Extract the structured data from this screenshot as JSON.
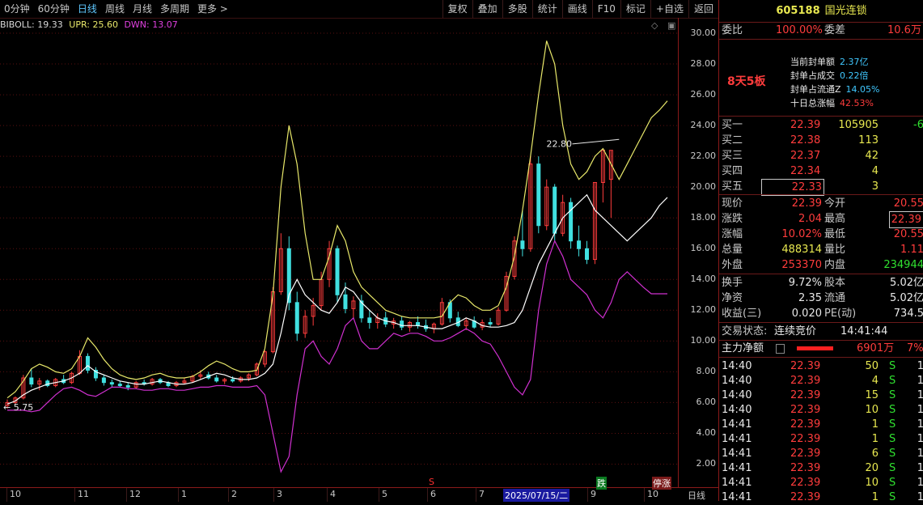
{
  "toolbar": {
    "periods": [
      "0分钟",
      "60分钟",
      "日线",
      "周线",
      "月线",
      "多周期",
      "更多 >"
    ],
    "active_period": "日线",
    "tools": [
      "复权",
      "叠加",
      "多股",
      "统计",
      "画线",
      "F10",
      "标记",
      "+自选",
      "返回"
    ]
  },
  "indicator": {
    "boll": "BIBOLL: 19.33",
    "upr": "UPR: 25.60",
    "dwn": "DWN: 13.07"
  },
  "y_axis_labels": [
    "30.00",
    "28.00",
    "26.00",
    "24.00",
    "22.00",
    "20.00",
    "18.00",
    "16.00",
    "14.00",
    "12.00",
    "10.00",
    "8.00",
    "6.00",
    "4.00",
    "2.00"
  ],
  "annotations": {
    "high_price": "22.80",
    "low_price": "5.75"
  },
  "x_axis": {
    "labels": [
      "10",
      "11",
      "12",
      "1",
      "2",
      "3",
      "4",
      "5",
      "6",
      "7",
      "9",
      "10"
    ],
    "cursor_date": "2025/07/15/二",
    "period": "日线",
    "mark_fall": "跌",
    "mark_halt": "停涨",
    "mark_s": "S"
  },
  "colors": {
    "up": "#ff3c3c",
    "down": "#40e0e0",
    "mid": "#ffffff",
    "upper": "#e8e86a",
    "lower": "#d030d0"
  },
  "chart_data": {
    "type": "line",
    "title": "",
    "ylim": [
      0.5,
      31
    ],
    "x": [
      0,
      1,
      2,
      3,
      4,
      5,
      6,
      7,
      8,
      9,
      10,
      11,
      12,
      13,
      14,
      15,
      16,
      17,
      18,
      19,
      20,
      21,
      22,
      23,
      24,
      25,
      26,
      27,
      28,
      29,
      30,
      31,
      32,
      33,
      34,
      35,
      36,
      37,
      38,
      39,
      40,
      41,
      42,
      43,
      44,
      45,
      46,
      47,
      48,
      49,
      50,
      51,
      52,
      53,
      54,
      55,
      56,
      57,
      58,
      59,
      60,
      61,
      62,
      63,
      64,
      65,
      66,
      67,
      68,
      69,
      70,
      71,
      72,
      73,
      74,
      75,
      76,
      77,
      78,
      79,
      80,
      81,
      82
    ],
    "series": [
      {
        "name": "BIBOLL",
        "values": [
          5.9,
          6.1,
          6.5,
          6.8,
          7.0,
          7.2,
          7.3,
          7.4,
          7.6,
          7.9,
          8.4,
          8.0,
          7.8,
          7.6,
          7.4,
          7.3,
          7.2,
          7.2,
          7.3,
          7.4,
          7.3,
          7.2,
          7.2,
          7.3,
          7.5,
          7.7,
          7.9,
          7.8,
          7.6,
          7.5,
          7.5,
          7.6,
          7.9,
          8.5,
          10.5,
          13.0,
          14.0,
          13.0,
          12.5,
          12.0,
          11.8,
          12.5,
          13.5,
          13.2,
          12.5,
          12.0,
          11.5,
          11.3,
          11.2,
          11.0,
          11.0,
          11.0,
          10.9,
          10.8,
          10.8,
          11.0,
          11.2,
          11.5,
          11.3,
          11.0,
          10.9,
          10.9,
          11.0,
          11.2,
          12.0,
          13.5,
          15.0,
          16.0,
          17.0,
          18.0,
          18.5,
          19.0,
          19.5,
          18.5,
          18.0,
          17.5,
          17.0,
          16.5,
          17.0,
          17.5,
          18.0,
          18.8,
          19.33
        ]
      },
      {
        "name": "UPR",
        "values": [
          6.3,
          6.7,
          7.4,
          8.2,
          8.5,
          8.3,
          8.0,
          7.9,
          8.2,
          9.0,
          10.2,
          9.6,
          8.8,
          8.2,
          7.8,
          7.6,
          7.5,
          7.6,
          7.8,
          7.9,
          7.7,
          7.6,
          7.6,
          7.7,
          8.0,
          8.4,
          8.7,
          8.5,
          8.2,
          8.0,
          8.0,
          8.1,
          9.5,
          13.0,
          20.0,
          24.0,
          21.5,
          17.0,
          14.0,
          14.0,
          15.5,
          17.5,
          16.5,
          14.5,
          13.5,
          13.0,
          12.5,
          12.0,
          11.8,
          11.6,
          11.5,
          11.5,
          11.5,
          11.5,
          11.6,
          12.5,
          13.0,
          12.8,
          12.3,
          12.0,
          12.0,
          12.3,
          13.5,
          15.5,
          18.5,
          22.0,
          26.0,
          29.5,
          28.0,
          24.0,
          21.5,
          20.5,
          21.0,
          22.0,
          22.5,
          21.5,
          20.5,
          21.5,
          22.5,
          23.5,
          24.5,
          25.0,
          25.6
        ]
      },
      {
        "name": "DWN",
        "values": [
          5.5,
          5.5,
          5.5,
          5.4,
          5.5,
          6.0,
          6.5,
          6.9,
          7.0,
          6.8,
          6.5,
          6.4,
          6.7,
          7.0,
          7.0,
          6.9,
          6.9,
          6.8,
          6.8,
          6.9,
          6.9,
          6.8,
          6.8,
          6.9,
          7.0,
          7.0,
          7.1,
          7.1,
          7.0,
          7.0,
          7.0,
          7.1,
          6.5,
          4.0,
          1.5,
          2.5,
          6.5,
          9.5,
          10.0,
          9.0,
          8.5,
          9.5,
          11.0,
          11.5,
          10.0,
          9.5,
          9.5,
          10.0,
          10.5,
          10.3,
          10.5,
          10.5,
          10.3,
          10.0,
          10.0,
          10.2,
          10.5,
          10.8,
          10.5,
          10.0,
          9.8,
          9.0,
          8.0,
          7.0,
          6.5,
          7.5,
          12.0,
          15.0,
          16.5,
          15.5,
          14.0,
          13.5,
          13.0,
          12.0,
          11.5,
          12.5,
          14.0,
          14.5,
          14.0,
          13.5,
          13.07,
          13.07,
          13.07
        ]
      }
    ],
    "candles": [
      [
        5.8,
        6.2,
        5.6,
        6.0
      ],
      [
        6.0,
        6.4,
        5.9,
        6.3
      ],
      [
        6.3,
        7.8,
        6.2,
        7.6
      ],
      [
        7.6,
        8.2,
        7.0,
        7.2
      ],
      [
        7.2,
        7.6,
        6.8,
        7.4
      ],
      [
        7.4,
        7.5,
        7.0,
        7.1
      ],
      [
        7.1,
        7.6,
        7.0,
        7.5
      ],
      [
        7.5,
        7.8,
        7.2,
        7.3
      ],
      [
        7.3,
        8.0,
        7.2,
        7.9
      ],
      [
        7.9,
        9.4,
        7.8,
        9.0
      ],
      [
        9.0,
        9.2,
        7.9,
        8.1
      ],
      [
        8.1,
        8.3,
        7.4,
        7.6
      ],
      [
        7.6,
        7.8,
        7.1,
        7.3
      ],
      [
        7.3,
        7.5,
        7.0,
        7.2
      ],
      [
        7.2,
        7.4,
        7.0,
        7.1
      ],
      [
        7.1,
        7.3,
        6.8,
        7.0
      ],
      [
        7.0,
        7.4,
        6.9,
        7.3
      ],
      [
        7.3,
        7.5,
        7.1,
        7.2
      ],
      [
        7.2,
        7.6,
        7.1,
        7.5
      ],
      [
        7.5,
        7.6,
        7.2,
        7.3
      ],
      [
        7.3,
        7.4,
        7.0,
        7.1
      ],
      [
        7.1,
        7.4,
        7.0,
        7.3
      ],
      [
        7.3,
        7.6,
        7.2,
        7.4
      ],
      [
        7.4,
        7.8,
        7.3,
        7.7
      ],
      [
        7.7,
        8.1,
        7.5,
        7.8
      ],
      [
        7.8,
        8.0,
        7.5,
        7.6
      ],
      [
        7.6,
        7.8,
        7.3,
        7.4
      ],
      [
        7.4,
        7.6,
        7.2,
        7.5
      ],
      [
        7.5,
        7.7,
        7.3,
        7.4
      ],
      [
        7.4,
        7.7,
        7.3,
        7.6
      ],
      [
        7.6,
        7.9,
        7.4,
        7.8
      ],
      [
        7.8,
        8.6,
        7.7,
        8.5
      ],
      [
        8.5,
        9.4,
        8.3,
        9.3
      ],
      [
        9.3,
        13.5,
        9.2,
        13.2
      ],
      [
        13.2,
        17.0,
        13.0,
        16.0
      ],
      [
        16.0,
        16.8,
        12.0,
        12.5
      ],
      [
        12.5,
        13.2,
        10.0,
        10.5
      ],
      [
        10.5,
        12.0,
        10.2,
        11.6
      ],
      [
        11.6,
        12.8,
        11.0,
        12.3
      ],
      [
        12.3,
        14.5,
        12.0,
        14.0
      ],
      [
        14.0,
        16.5,
        13.5,
        16.0
      ],
      [
        16.0,
        16.2,
        12.5,
        13.0
      ],
      [
        13.0,
        13.8,
        11.8,
        12.1
      ],
      [
        12.1,
        12.9,
        11.5,
        12.6
      ],
      [
        12.6,
        13.0,
        11.2,
        11.5
      ],
      [
        11.5,
        12.0,
        10.8,
        11.2
      ],
      [
        11.2,
        11.8,
        10.8,
        11.5
      ],
      [
        11.5,
        11.9,
        10.9,
        11.1
      ],
      [
        11.1,
        11.5,
        10.8,
        11.3
      ],
      [
        11.3,
        11.6,
        10.7,
        10.9
      ],
      [
        10.9,
        11.3,
        10.6,
        11.2
      ],
      [
        11.2,
        11.6,
        10.8,
        11.0
      ],
      [
        11.0,
        11.4,
        10.6,
        10.8
      ],
      [
        10.8,
        11.2,
        10.5,
        11.1
      ],
      [
        11.1,
        12.8,
        11.0,
        12.5
      ],
      [
        12.5,
        12.7,
        11.2,
        11.5
      ],
      [
        11.5,
        11.9,
        10.9,
        11.0
      ],
      [
        11.0,
        11.5,
        10.7,
        11.3
      ],
      [
        11.3,
        11.6,
        10.8,
        10.9
      ],
      [
        10.9,
        11.4,
        10.7,
        11.2
      ],
      [
        11.2,
        11.5,
        10.9,
        11.1
      ],
      [
        11.1,
        12.2,
        11.0,
        12.0
      ],
      [
        12.0,
        14.5,
        11.9,
        14.2
      ],
      [
        14.2,
        16.8,
        14.0,
        16.5
      ],
      [
        16.5,
        18.5,
        15.5,
        16.0
      ],
      [
        16.0,
        22.0,
        15.8,
        21.5
      ],
      [
        21.5,
        22.0,
        17.0,
        17.5
      ],
      [
        17.5,
        20.5,
        17.2,
        20.0
      ],
      [
        20.0,
        20.2,
        16.5,
        17.0
      ],
      [
        17.0,
        19.5,
        16.8,
        19.0
      ],
      [
        19.0,
        19.3,
        16.0,
        16.5
      ],
      [
        16.5,
        17.5,
        15.5,
        16.0
      ],
      [
        16.0,
        16.5,
        15.0,
        15.3
      ],
      [
        15.3,
        20.3,
        15.0,
        20.3
      ],
      [
        20.3,
        22.4,
        19.0,
        22.4
      ],
      [
        20.5,
        22.4,
        18.0,
        22.39
      ]
    ]
  },
  "panel": {
    "code": "605188",
    "name": "国光连锁",
    "weibi_label": "委比",
    "weibi_value": "100.00%",
    "weicha_label": "委差",
    "weicha_value": "10.6万",
    "seal_title": "8天5板",
    "seal_lines": [
      {
        "label": "当前封单额",
        "value": "2.37亿"
      },
      {
        "label": "封单占成交",
        "value": "0.22倍"
      },
      {
        "label": "封单占流通Z",
        "value": "14.05%"
      },
      {
        "label": "十日总涨幅",
        "value": "42.53%"
      }
    ],
    "bids": [
      {
        "label": "买一",
        "price": "22.39",
        "vol": "105905",
        "chg": "-6"
      },
      {
        "label": "买二",
        "price": "22.38",
        "vol": "113",
        "chg": ""
      },
      {
        "label": "买三",
        "price": "22.37",
        "vol": "42",
        "chg": ""
      },
      {
        "label": "买四",
        "price": "22.34",
        "vol": "4",
        "chg": ""
      },
      {
        "label": "买五",
        "price": "22.33",
        "vol": "3",
        "chg": ""
      }
    ],
    "quote": [
      {
        "l1": "现价",
        "v1": "22.39",
        "l2": "今开",
        "v2": "20.55"
      },
      {
        "l1": "涨跌",
        "v1": "2.04",
        "l2": "最高",
        "v2": "22.39"
      },
      {
        "l1": "涨幅",
        "v1": "10.02%",
        "l2": "最低",
        "v2": "20.55"
      },
      {
        "l1": "总量",
        "v1": "488314",
        "l2": "量比",
        "v2": "1.11"
      },
      {
        "l1": "外盘",
        "v1": "253370",
        "l2": "内盘",
        "v2": "234944"
      }
    ],
    "fund": [
      {
        "l1": "换手",
        "v1": "9.72%",
        "l2": "股本",
        "v2": "5.02亿"
      },
      {
        "l1": "净资",
        "v1": "2.35",
        "l2": "流通",
        "v2": "5.02亿"
      },
      {
        "l1": "收益(三)",
        "v1": "0.020",
        "l2": "PE(动)",
        "v2": "734.5"
      }
    ],
    "status_label": "交易状态:",
    "status_value": "连续竞价",
    "status_time": "14:41:44",
    "main_flow_label": "主力净额",
    "main_flow_value": "6901万",
    "main_flow_pct": "7%",
    "trades": [
      {
        "time": "14:40",
        "price": "22.39",
        "vol": "50",
        "side": "S",
        "n": "1"
      },
      {
        "time": "14:40",
        "price": "22.39",
        "vol": "4",
        "side": "S",
        "n": "1"
      },
      {
        "time": "14:40",
        "price": "22.39",
        "vol": "15",
        "side": "S",
        "n": "1"
      },
      {
        "time": "14:40",
        "price": "22.39",
        "vol": "10",
        "side": "S",
        "n": "1"
      },
      {
        "time": "14:41",
        "price": "22.39",
        "vol": "1",
        "side": "S",
        "n": "1"
      },
      {
        "time": "14:41",
        "price": "22.39",
        "vol": "1",
        "side": "S",
        "n": "1"
      },
      {
        "time": "14:41",
        "price": "22.39",
        "vol": "6",
        "side": "S",
        "n": "1"
      },
      {
        "time": "14:41",
        "price": "22.39",
        "vol": "20",
        "side": "S",
        "n": "1"
      },
      {
        "time": "14:41",
        "price": "22.39",
        "vol": "10",
        "side": "S",
        "n": "1"
      },
      {
        "time": "14:41",
        "price": "22.39",
        "vol": "1",
        "side": "S",
        "n": "1"
      }
    ]
  }
}
